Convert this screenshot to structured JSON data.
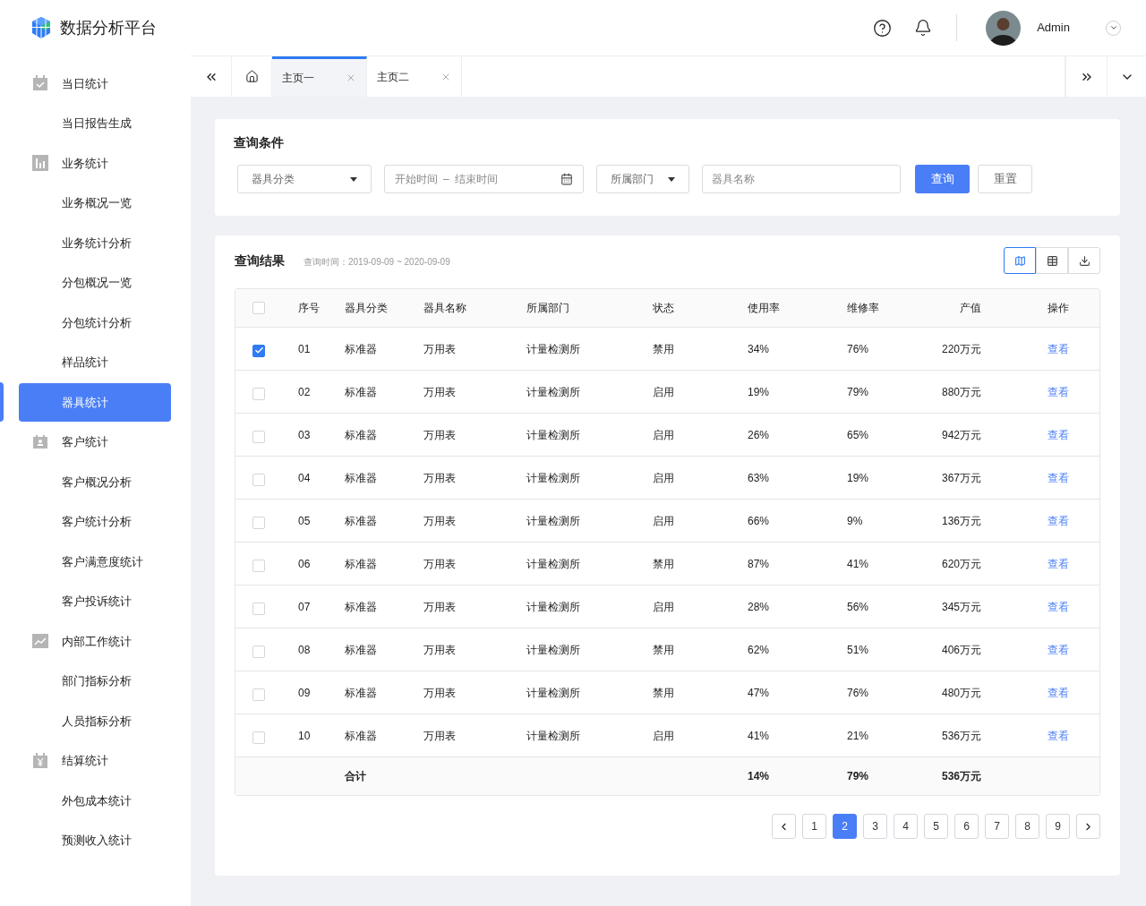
{
  "header": {
    "title": "数据分析平台",
    "user": "Admin"
  },
  "sidebar": {
    "groups": [
      {
        "label": "当日统计",
        "children": [
          {
            "label": "当日报告生成",
            "selected": false
          }
        ]
      },
      {
        "label": "业务统计",
        "children": [
          {
            "label": "业务概况一览",
            "selected": false
          },
          {
            "label": "业务统计分析",
            "selected": false
          },
          {
            "label": "分包概况一览",
            "selected": false
          },
          {
            "label": "分包统计分析",
            "selected": false
          },
          {
            "label": "样品统计",
            "selected": false
          },
          {
            "label": "器具统计",
            "selected": true
          }
        ]
      },
      {
        "label": "客户统计",
        "children": [
          {
            "label": "客户概况分析",
            "selected": false
          },
          {
            "label": "客户统计分析",
            "selected": false
          },
          {
            "label": "客户满意度统计",
            "selected": false
          },
          {
            "label": "客户投诉统计",
            "selected": false
          }
        ]
      },
      {
        "label": "内部工作统计",
        "children": [
          {
            "label": "部门指标分析",
            "selected": false
          },
          {
            "label": "人员指标分析",
            "selected": false
          }
        ]
      },
      {
        "label": "结算统计",
        "children": [
          {
            "label": "外包成本统计",
            "selected": false
          },
          {
            "label": "预测收入统计",
            "selected": false
          }
        ]
      }
    ]
  },
  "tabs": [
    {
      "label": "主页一",
      "selected": true
    },
    {
      "label": "主页二",
      "selected": false
    }
  ],
  "query": {
    "title": "查询条件",
    "filters": [
      {
        "kind": "select",
        "placeholder": "器具分类"
      },
      {
        "kind": "daterange",
        "start_placeholder": "开始时间",
        "separator": "–",
        "end_placeholder": "结束时间"
      },
      {
        "kind": "select",
        "placeholder": "所属部门"
      },
      {
        "kind": "input",
        "placeholder": "器具名称"
      }
    ],
    "buttons": [
      {
        "label": "查询",
        "kind": "primary"
      },
      {
        "label": "重置",
        "kind": "default"
      }
    ]
  },
  "results": {
    "title": "查询结果",
    "subtitle": "查询时间：2019-09-09 ~ 2020-09-09",
    "views": [
      {
        "kind": "map",
        "selected": true
      },
      {
        "kind": "table",
        "selected": false
      },
      {
        "kind": "download",
        "selected": false
      }
    ],
    "table": {
      "all_checked": false,
      "columns": [
        "序号",
        "器具分类",
        "器具名称",
        "所属部门",
        "状态",
        "使用率",
        "维修率",
        "产值",
        "操作"
      ],
      "rows": [
        {
          "checked": true,
          "cells": [
            "01",
            "标准器",
            "万用表",
            "计量检测所",
            "禁用",
            "34%",
            "76%",
            "220万元"
          ],
          "action": "查看"
        },
        {
          "checked": false,
          "cells": [
            "02",
            "标准器",
            "万用表",
            "计量检测所",
            "启用",
            "19%",
            "79%",
            "880万元"
          ],
          "action": "查看"
        },
        {
          "checked": false,
          "cells": [
            "03",
            "标准器",
            "万用表",
            "计量检测所",
            "启用",
            "26%",
            "65%",
            "942万元"
          ],
          "action": "查看"
        },
        {
          "checked": false,
          "cells": [
            "04",
            "标准器",
            "万用表",
            "计量检测所",
            "启用",
            "63%",
            "19%",
            "367万元"
          ],
          "action": "查看"
        },
        {
          "checked": false,
          "cells": [
            "05",
            "标准器",
            "万用表",
            "计量检测所",
            "启用",
            "66%",
            "9%",
            "136万元"
          ],
          "action": "查看"
        },
        {
          "checked": false,
          "cells": [
            "06",
            "标准器",
            "万用表",
            "计量检测所",
            "禁用",
            "87%",
            "41%",
            "620万元"
          ],
          "action": "查看"
        },
        {
          "checked": false,
          "cells": [
            "07",
            "标准器",
            "万用表",
            "计量检测所",
            "启用",
            "28%",
            "56%",
            "345万元"
          ],
          "action": "查看"
        },
        {
          "checked": false,
          "cells": [
            "08",
            "标准器",
            "万用表",
            "计量检测所",
            "禁用",
            "62%",
            "51%",
            "406万元"
          ],
          "action": "查看"
        },
        {
          "checked": false,
          "cells": [
            "09",
            "标准器",
            "万用表",
            "计量检测所",
            "禁用",
            "47%",
            "76%",
            "480万元"
          ],
          "action": "查看"
        },
        {
          "checked": false,
          "cells": [
            "10",
            "标准器",
            "万用表",
            "计量检测所",
            "启用",
            "41%",
            "21%",
            "536万元"
          ],
          "action": "查看"
        }
      ],
      "summary": {
        "label": "合计",
        "usage": "14%",
        "repair": "79%",
        "value": "536万元"
      }
    },
    "pagination": [
      {
        "label": "1",
        "selected": false
      },
      {
        "label": "2",
        "selected": true
      },
      {
        "label": "3",
        "selected": false
      },
      {
        "label": "4",
        "selected": false
      },
      {
        "label": "5",
        "selected": false
      },
      {
        "label": "6",
        "selected": false
      },
      {
        "label": "7",
        "selected": false
      },
      {
        "label": "8",
        "selected": false
      },
      {
        "label": "9",
        "selected": false
      }
    ]
  }
}
